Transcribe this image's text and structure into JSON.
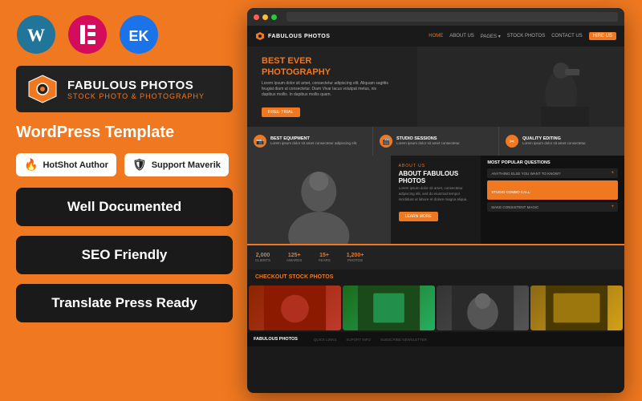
{
  "background_color": "#F07820",
  "left": {
    "plugin_logos": [
      {
        "name": "WordPress",
        "color": "#21759B"
      },
      {
        "name": "Elementor",
        "color": "#D30C5C"
      },
      {
        "name": "Extra",
        "color": "#1565C0"
      }
    ],
    "brand": {
      "title": "FABULOUS PHOTOS",
      "subtitle": "STOCK PHOTO & PHOTOGRAPHY"
    },
    "wordpress_template_label": "WordPress Template",
    "badges": [
      {
        "icon": "🔥",
        "label": "HotShot Author"
      },
      {
        "icon": "🛡",
        "label": "Support Maverik"
      }
    ],
    "features": [
      {
        "label": "Well Documented"
      },
      {
        "label": "SEO Friendly"
      },
      {
        "label": "Translate Press Ready"
      }
    ]
  },
  "right": {
    "browser": {
      "nav_links": [
        "HOME",
        "ABOUT US",
        "PAGES",
        "STOCK PHOTOS",
        "CONTACT US"
      ],
      "nav_cta": "HIRE US",
      "hero": {
        "title_line1": "BEST EVER",
        "title_line2_highlight": "PHOTOGRAPHY",
        "description": "Lorem ipsum dolor sit amet, consectetur adipiscing elit. Aliquam sagittis feugiat diam ut consectetur. Diam Vivar lacus volutpat metus, nis dapibus mollis. In dapibus mollis quam.",
        "cta": "FREE TRIAL"
      },
      "features": [
        {
          "icon": "📷",
          "title": "BEST EQUIPMENT",
          "desc": "Lorem ipsum dolor sit amet consectetur adipiscing elit."
        },
        {
          "icon": "🎬",
          "title": "STUDIO SESSIONS",
          "desc": "Lorem ipsum dolor sit amet consectetur."
        },
        {
          "icon": "✂",
          "title": "QUALITY EDITING",
          "desc": "Lorem ipsum dolor sit amet consectetur."
        }
      ],
      "about": {
        "label": "ABOUT US",
        "title": "ABOUT FABULOUS PHOTOS",
        "description": "Lorem ipsum dolor sit amet, consectetur adipiscing elit, sed do eiusmod tempor incididunt ut labore et dolore magna aliqua.",
        "cta": "LEARN MORE"
      },
      "stats": [
        {
          "number": "2,000",
          "label": "CLIENTS"
        },
        {
          "number": "125+",
          "label": "AWARDS"
        },
        {
          "number": "15+",
          "label": "YEARS"
        },
        {
          "number": "1,200+",
          "label": "PHOTOS"
        }
      ],
      "checkout_title": "CHECKOUT ",
      "checkout_highlight": "STOCK PHOTOS",
      "footer_brand": "FABULOUS PHOTOS"
    }
  }
}
